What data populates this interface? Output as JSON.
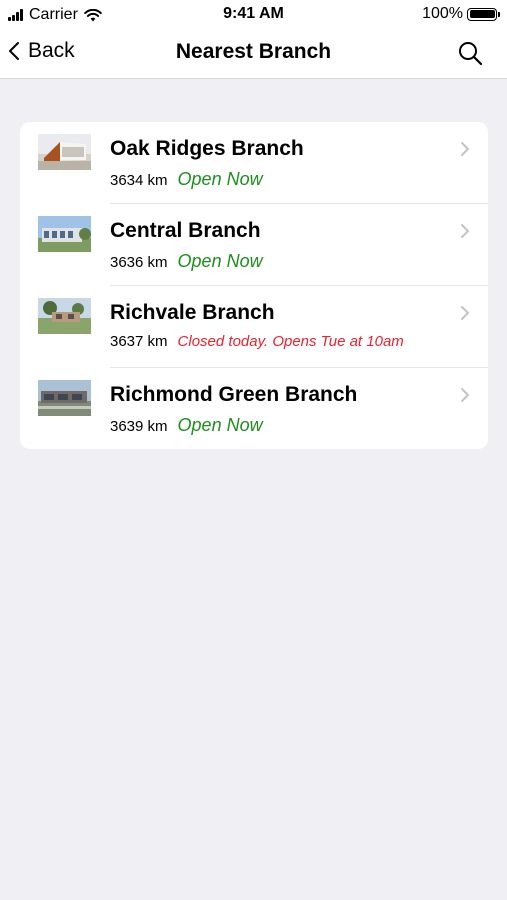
{
  "status_bar": {
    "carrier": "Carrier",
    "time": "9:41 AM",
    "battery": "100%",
    "battery_level": 1.0
  },
  "nav": {
    "back_label": "Back",
    "title": "Nearest Branch",
    "search_icon": "search-icon"
  },
  "branches": [
    {
      "name": "Oak Ridges Branch",
      "distance": "3634 km",
      "status": "Open Now",
      "open": true
    },
    {
      "name": "Central Branch",
      "distance": "3636 km",
      "status": "Open Now",
      "open": true
    },
    {
      "name": "Richvale Branch",
      "distance": "3637 km",
      "status": "Closed today. Opens Tue at 10am",
      "open": false
    },
    {
      "name": "Richmond Green Branch",
      "distance": "3639 km",
      "status": "Open Now",
      "open": true
    }
  ],
  "colors": {
    "open": "#1e8f1e",
    "closed": "#e8232f",
    "background": "#efeff4"
  }
}
